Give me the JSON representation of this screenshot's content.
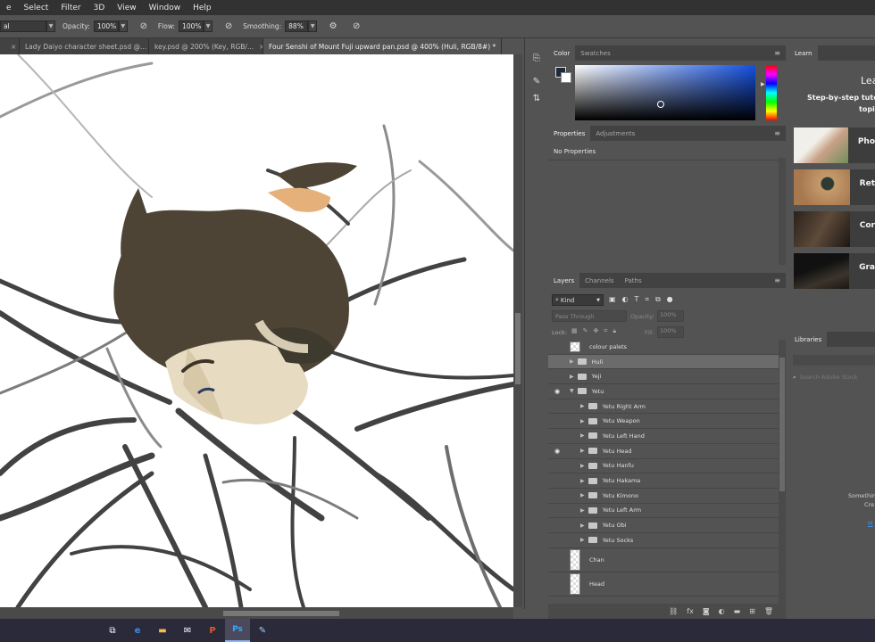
{
  "menu": [
    "e",
    "Select",
    "Filter",
    "3D",
    "View",
    "Window",
    "Help"
  ],
  "options": {
    "mode_value": "al",
    "opacity_label": "Opacity:",
    "opacity_value": "100%",
    "flow_label": "Flow:",
    "flow_value": "100%",
    "smoothing_label": "Smoothing:",
    "smoothing_value": "88%"
  },
  "tabs": [
    {
      "label": "Lady Daiyo character sheet.psd @..."
    },
    {
      "label": "key.psd @ 200% (Key, RGB/..."
    },
    {
      "label": "Four Senshi of Mount Fuji upward pan.psd @ 400% (Huli, RGB/8#) *"
    }
  ],
  "color_panel": {
    "tabs": [
      "Color",
      "Swatches"
    ]
  },
  "props_panel": {
    "tabs": [
      "Properties",
      "Adjustments"
    ],
    "empty_text": "No Properties"
  },
  "layers_panel": {
    "tabs": [
      "Layers",
      "Channels",
      "Paths"
    ],
    "kind_label": "Kind",
    "blend_mode": "Pass Through",
    "opacity_label": "Opacity:",
    "opacity_value": "100%",
    "lock_label": "Lock:",
    "fill_label": "Fill:",
    "fill_value": "100%",
    "layers": [
      {
        "name": "colour palets",
        "type": "layer",
        "visible": false,
        "indent": 0
      },
      {
        "name": "Huli",
        "type": "folder",
        "visible": false,
        "indent": 0,
        "selected": true
      },
      {
        "name": "Yeji",
        "type": "folder",
        "visible": false,
        "indent": 0
      },
      {
        "name": "Yetu",
        "type": "folder",
        "visible": true,
        "indent": 0,
        "open": true
      },
      {
        "name": "Yetu Right Arm",
        "type": "folder",
        "visible": false,
        "indent": 1
      },
      {
        "name": "Yetu Weapon",
        "type": "folder",
        "visible": false,
        "indent": 1
      },
      {
        "name": "Yetu Left Hand",
        "type": "folder",
        "visible": false,
        "indent": 1
      },
      {
        "name": "Yetu Head",
        "type": "folder",
        "visible": true,
        "indent": 1
      },
      {
        "name": "Yetu Hanfu",
        "type": "folder",
        "visible": false,
        "indent": 1
      },
      {
        "name": "Yetu Hakama",
        "type": "folder",
        "visible": false,
        "indent": 1
      },
      {
        "name": "Yetu Kimono",
        "type": "folder",
        "visible": false,
        "indent": 1
      },
      {
        "name": "Yetu Left Arm",
        "type": "folder",
        "visible": false,
        "indent": 1
      },
      {
        "name": "Yetu Obi",
        "type": "folder",
        "visible": false,
        "indent": 1
      },
      {
        "name": "Yetu Socks",
        "type": "folder",
        "visible": false,
        "indent": 1
      },
      {
        "name": "Chan",
        "type": "layer",
        "visible": false,
        "indent": 0
      },
      {
        "name": "Head",
        "type": "layer",
        "visible": false,
        "indent": 0
      }
    ]
  },
  "learn_panel": {
    "tab": "Learn",
    "heading": "Lea",
    "subheading": "Step-by-step tuto",
    "subheading2": "topic",
    "cards": [
      {
        "label": "Pho"
      },
      {
        "label": "Ret"
      },
      {
        "label": "Cor"
      },
      {
        "label": "Gra"
      }
    ]
  },
  "libraries_panel": {
    "tab": "Libraries",
    "search_placeholder": "Search Adobe Stock",
    "msg1": "Somethin",
    "msg2": "Cre",
    "link": "M"
  },
  "taskbar": [
    "task-view",
    "edge",
    "file-explorer",
    "mail",
    "powerpoint",
    "photoshop",
    "paint"
  ],
  "colors": {
    "accent": "#1473e6",
    "panel_bg": "#535353",
    "header_bg": "#424242"
  }
}
